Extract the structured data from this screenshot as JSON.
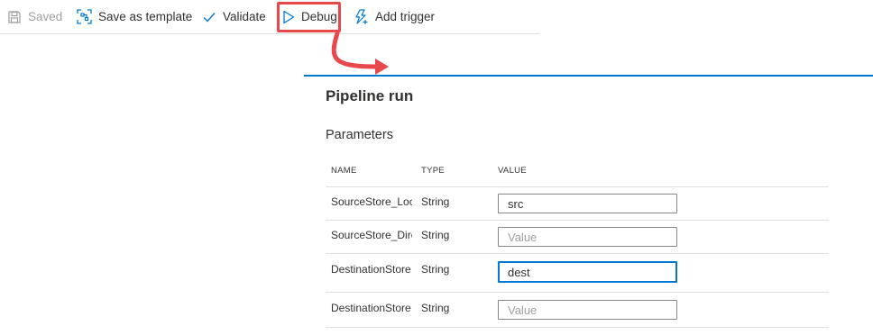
{
  "toolbar": {
    "saved_label": "Saved",
    "save_template_label": "Save as template",
    "validate_label": "Validate",
    "debug_label": "Debug",
    "add_trigger_label": "Add trigger"
  },
  "panel": {
    "title": "Pipeline run",
    "parameters_heading": "Parameters",
    "columns": {
      "name": "NAME",
      "type": "TYPE",
      "value": "VALUE"
    },
    "rows": [
      {
        "name": "SourceStore_Loc",
        "type": "String",
        "value": "src",
        "placeholder": "Value"
      },
      {
        "name": "SourceStore_Dire",
        "type": "String",
        "value": "",
        "placeholder": "Value"
      },
      {
        "name": "DestinationStore",
        "type": "String",
        "value": "dest",
        "placeholder": "Value"
      },
      {
        "name": "DestinationStore",
        "type": "String",
        "value": "",
        "placeholder": "Value"
      }
    ]
  },
  "colors": {
    "accent": "#0078d4",
    "highlight": "#e8474b",
    "text": "#323130",
    "disabled_text": "#a19f9d",
    "border": "#e1dfdd"
  },
  "icons": {
    "saved": "save-icon",
    "save_template": "template-icon",
    "validate": "checkmark-icon",
    "debug": "play-icon",
    "add_trigger": "lightning-add-icon"
  }
}
